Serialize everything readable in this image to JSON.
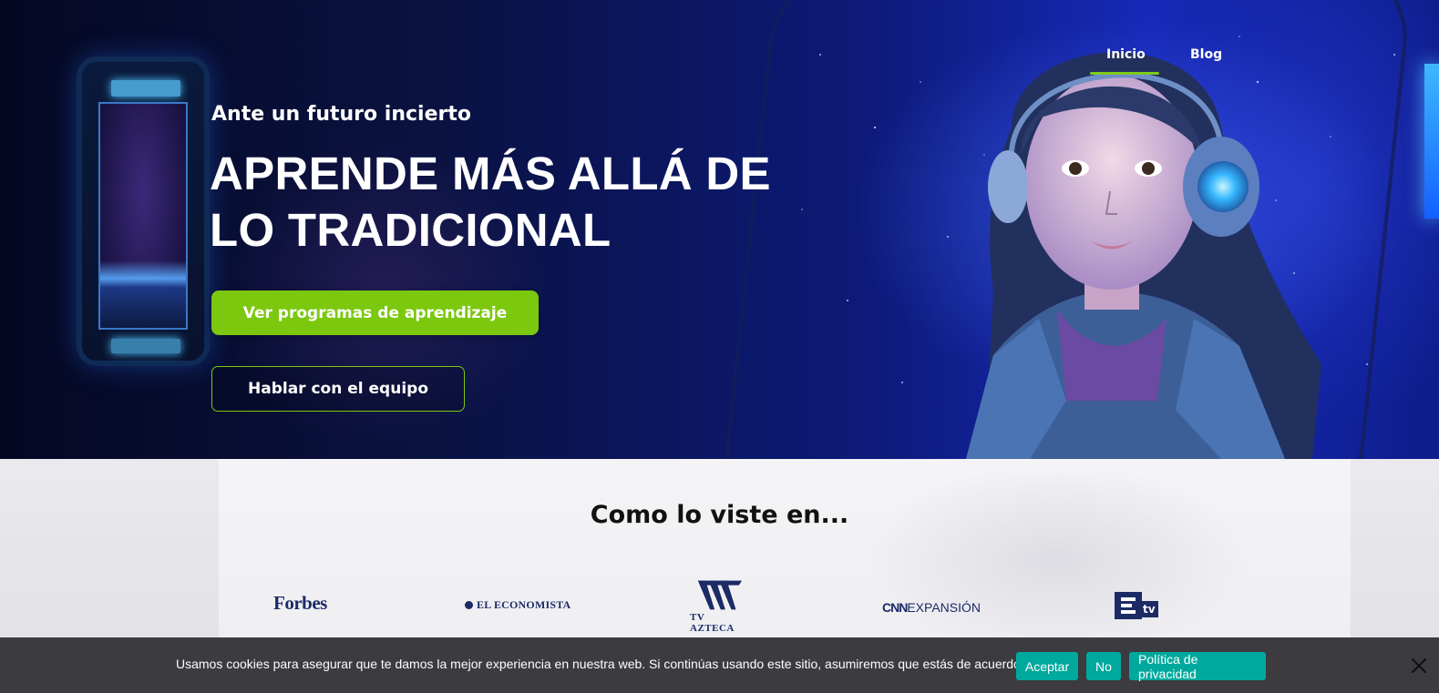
{
  "nav": {
    "items": [
      {
        "label": "Inicio",
        "active": true
      },
      {
        "label": "Blog",
        "active": false
      }
    ],
    "active_underline_color": "#7ecb1a"
  },
  "hero": {
    "eyebrow": "Ante un futuro incierto",
    "headline_line1": "APRENDE MÁS ALLÁ DE",
    "headline_line2": "LO TRADICIONAL",
    "primary_cta": "Ver programas de aprendizaje",
    "secondary_cta": "Hablar con el equipo",
    "accent_color": "#7cc80f"
  },
  "press": {
    "title": "Como lo viste en...",
    "logos": [
      {
        "name": "Forbes",
        "text": "Forbes"
      },
      {
        "name": "El Economista",
        "text": "EL ECONOMISTA"
      },
      {
        "name": "TV Azteca",
        "text": "TV AZTECA"
      },
      {
        "name": "CNN Expansión",
        "text_cnn": "CNN",
        "text_rest": "EXPANSIÓN"
      },
      {
        "name": "Etv",
        "text": "tv"
      }
    ],
    "logo_color": "#1c2a66"
  },
  "cookie_bar": {
    "message": "Usamos cookies para asegurar que te damos la mejor experiencia en nuestra web. Si continúas usando este sitio, asumiremos que estás de acuerdo con ello.",
    "accept_label": "Aceptar",
    "no_label": "No",
    "policy_label": "Política de privacidad",
    "button_color": "#00a99d",
    "background_color": "#3b3b40"
  }
}
